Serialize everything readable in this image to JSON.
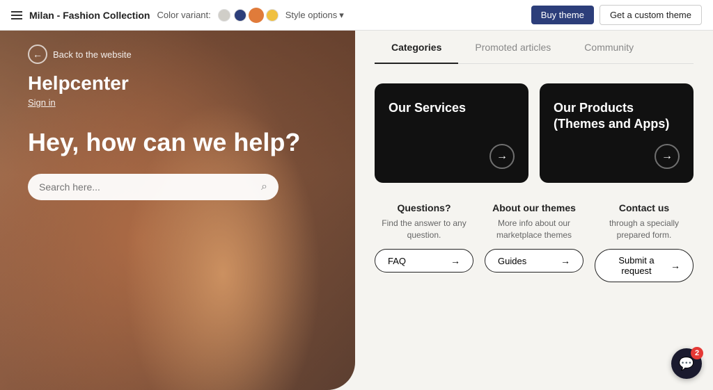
{
  "navbar": {
    "title": "Milan - Fashion Collection",
    "color_variant_label": "Color variant:",
    "colors": [
      {
        "name": "grey",
        "hex": "#d0cec8"
      },
      {
        "name": "blue",
        "hex": "#2c3e7a"
      },
      {
        "name": "orange",
        "hex": "#e07b3a"
      },
      {
        "name": "yellow",
        "hex": "#f0c040"
      }
    ],
    "style_options_label": "Style options",
    "buy_theme_label": "Buy theme",
    "custom_theme_label": "Get a custom theme"
  },
  "left": {
    "back_label": "Back to the website",
    "helpcenter_title": "Helpcenter",
    "signin_label": "Sign in",
    "hero_heading": "Hey, how can we help?",
    "search_placeholder": "Search here..."
  },
  "tabs": [
    {
      "id": "categories",
      "label": "Categories",
      "active": true
    },
    {
      "id": "promoted",
      "label": "Promoted articles",
      "active": false
    },
    {
      "id": "community",
      "label": "Community",
      "active": false
    }
  ],
  "category_cards": [
    {
      "id": "services",
      "title": "Our Services"
    },
    {
      "id": "products",
      "title": "Our Products (Themes and Apps)"
    }
  ],
  "bottom_cards": [
    {
      "id": "faq",
      "title": "Questions?",
      "description": "Find the answer to any question.",
      "button_label": "FAQ"
    },
    {
      "id": "guides",
      "title": "About our themes",
      "description": "More info about our marketplace themes",
      "button_label": "Guides"
    },
    {
      "id": "submit",
      "title": "Contact us",
      "description": "through a specially prepared form.",
      "button_label": "Submit a request"
    }
  ],
  "chat": {
    "badge_count": "2"
  },
  "icons": {
    "hamburger": "☰",
    "back_arrow": "←",
    "search": "⌕",
    "arrow_right": "→",
    "chevron_down": "▾",
    "chat": "💬"
  }
}
